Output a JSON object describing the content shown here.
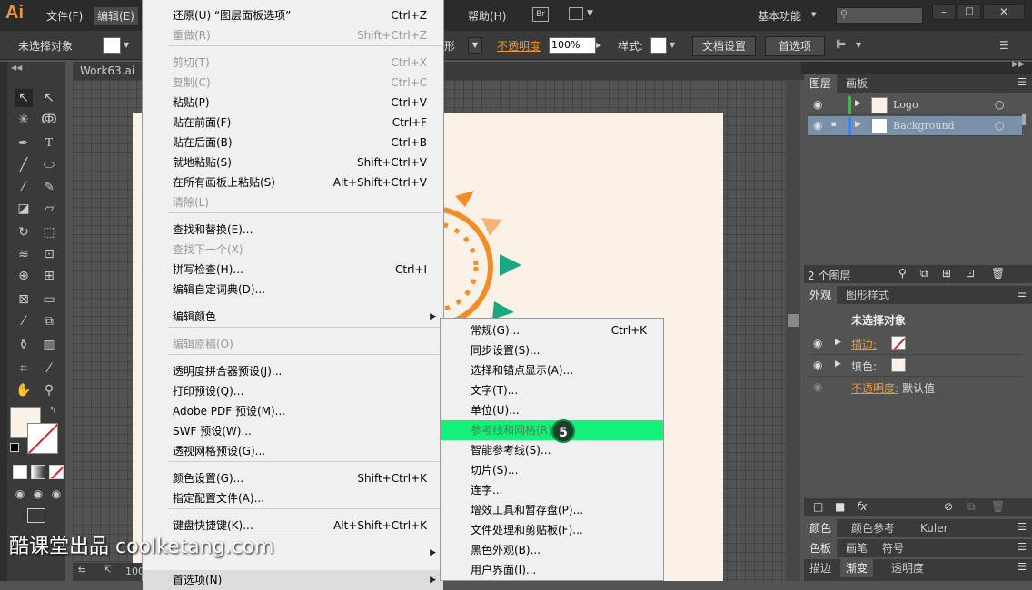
{
  "menubar": {
    "logo": "Ai",
    "items": [
      "文件(F)",
      "编辑(E)"
    ],
    "help": "帮助(H)",
    "br": "Br",
    "workspace": "基本功能",
    "search_placeholder": ""
  },
  "controlbar": {
    "no_selection": "未选择对象",
    "shape_label": "形",
    "opacity_label": "不透明度",
    "opacity_value": "100%",
    "style_label": "样式:",
    "doc_settings": "文档设置",
    "prefs": "首选项"
  },
  "doc_tab": "Work63.ai",
  "edit_menu": [
    {
      "label": "还原(U) “图层面板选项”",
      "shortcut": "Ctrl+Z",
      "disabled": false
    },
    {
      "label": "重做(R)",
      "shortcut": "Shift+Ctrl+Z",
      "disabled": true
    },
    {
      "label": "剪切(T)",
      "shortcut": "Ctrl+X",
      "disabled": true
    },
    {
      "label": "复制(C)",
      "shortcut": "Ctrl+C",
      "disabled": true
    },
    {
      "label": "粘贴(P)",
      "shortcut": "Ctrl+V",
      "disabled": false
    },
    {
      "label": "贴在前面(F)",
      "shortcut": "Ctrl+F",
      "disabled": false
    },
    {
      "label": "贴在后面(B)",
      "shortcut": "Ctrl+B",
      "disabled": false
    },
    {
      "label": "就地粘贴(S)",
      "shortcut": "Shift+Ctrl+V",
      "disabled": false
    },
    {
      "label": "在所有画板上粘贴(S)",
      "shortcut": "Alt+Shift+Ctrl+V",
      "disabled": false
    },
    {
      "label": "清除(L)",
      "shortcut": "",
      "disabled": true
    },
    {
      "label": "查找和替换(E)...",
      "shortcut": "",
      "disabled": false
    },
    {
      "label": "查找下一个(X)",
      "shortcut": "",
      "disabled": true
    },
    {
      "label": "拼写检查(H)...",
      "shortcut": "Ctrl+I",
      "disabled": false
    },
    {
      "label": "编辑自定词典(D)...",
      "shortcut": "",
      "disabled": false
    },
    {
      "label": "编辑颜色",
      "shortcut": "",
      "disabled": false
    },
    {
      "label": "编辑原稿(O)",
      "shortcut": "",
      "disabled": true
    },
    {
      "label": "透明度拼合器预设(J)...",
      "shortcut": "",
      "disabled": false
    },
    {
      "label": "打印预设(Q)...",
      "shortcut": "",
      "disabled": false
    },
    {
      "label": "Adobe PDF 预设(M)...",
      "shortcut": "",
      "disabled": false
    },
    {
      "label": "SWF 预设(W)...",
      "shortcut": "",
      "disabled": false
    },
    {
      "label": "透视网格预设(G)...",
      "shortcut": "",
      "disabled": false
    },
    {
      "label": "颜色设置(G)...",
      "shortcut": "Shift+Ctrl+K",
      "disabled": false
    },
    {
      "label": "指定配置文件(A)...",
      "shortcut": "",
      "disabled": false
    },
    {
      "label": "键盘快捷键(K)...",
      "shortcut": "Alt+Shift+Ctrl+K",
      "disabled": false
    },
    {
      "label": "",
      "shortcut": "",
      "disabled": false
    },
    {
      "label": "首选项(N)",
      "shortcut": "",
      "disabled": false
    }
  ],
  "prefs_menu": [
    {
      "label": "常规(G)...",
      "shortcut": "Ctrl+K"
    },
    {
      "label": "同步设置(S)...",
      "shortcut": ""
    },
    {
      "label": "选择和锚点显示(A)...",
      "shortcut": ""
    },
    {
      "label": "文字(T)...",
      "shortcut": ""
    },
    {
      "label": "单位(U)...",
      "shortcut": ""
    },
    {
      "label": "参考线和网格(R)...",
      "shortcut": ""
    },
    {
      "label": "智能参考线(S)...",
      "shortcut": ""
    },
    {
      "label": "切片(S)...",
      "shortcut": ""
    },
    {
      "label": "连字...",
      "shortcut": ""
    },
    {
      "label": "增效工具和暂存盘(P)...",
      "shortcut": ""
    },
    {
      "label": "文件处理和剪贴板(F)...",
      "shortcut": ""
    },
    {
      "label": "黑色外观(B)...",
      "shortcut": ""
    },
    {
      "label": "用户界面(I)...",
      "shortcut": ""
    }
  ],
  "step_badge": "5",
  "layers_panel": {
    "tabs": [
      "图层",
      "画板"
    ],
    "layers": [
      {
        "name": "Logo",
        "color": "#4caf50"
      },
      {
        "name": "Background",
        "color": "#4080e0"
      }
    ],
    "count": "2 个图层"
  },
  "appearance_panel": {
    "tabs": [
      "外观",
      "图形样式"
    ],
    "title": "未选择对象",
    "stroke_label": "描边:",
    "fill_label": "填色:",
    "opacity_label": "不透明度:",
    "opacity_value": "默认值"
  },
  "color_panel": {
    "tabs": [
      "颜色",
      "颜色参考",
      "Kuler"
    ]
  },
  "swatch_panel": {
    "tabs": [
      "色板",
      "画笔",
      "符号"
    ]
  },
  "gradient_panel": {
    "tabs": [
      "描边",
      "渐变",
      "透明度"
    ]
  },
  "status": {
    "zoom": "100"
  },
  "watermark": "酷课堂出品 coolketang.com",
  "colors": {
    "highlight": "#14f07a",
    "accent": "#e8983a"
  }
}
